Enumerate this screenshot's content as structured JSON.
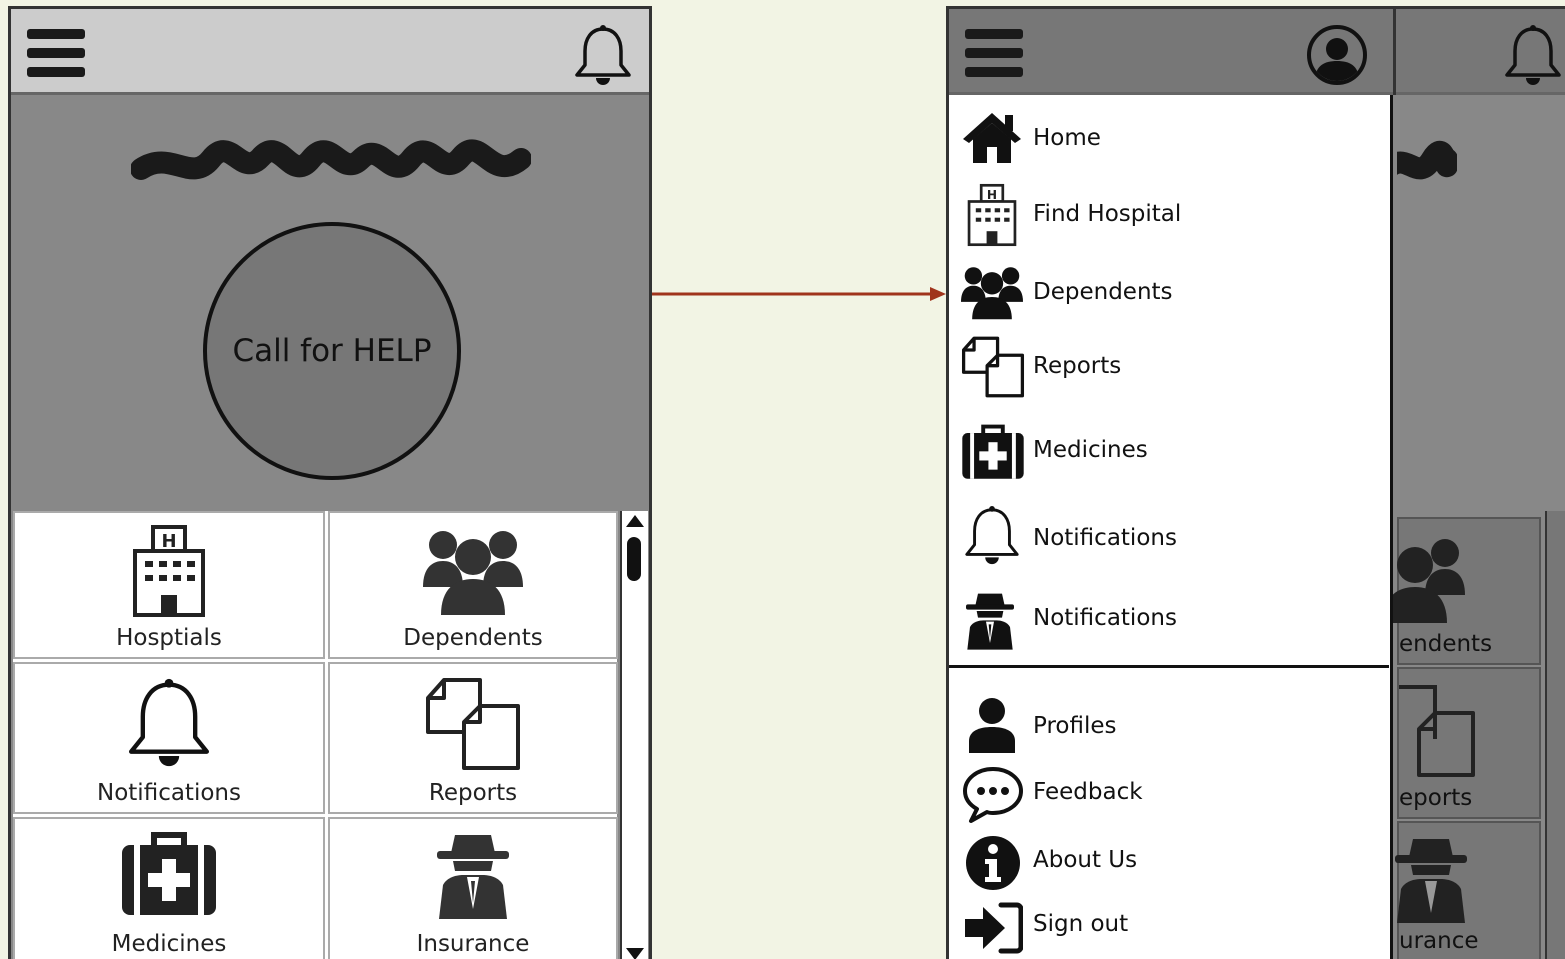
{
  "left_screen": {
    "help_button_label": "Call for HELP",
    "tiles": [
      {
        "label": "Hosptials",
        "icon": "hospital-icon"
      },
      {
        "label": "Dependents",
        "icon": "group-icon"
      },
      {
        "label": "Notifications",
        "icon": "bell-icon"
      },
      {
        "label": "Reports",
        "icon": "documents-icon"
      },
      {
        "label": "Medicines",
        "icon": "medical-kit-icon"
      },
      {
        "label": "Insurance",
        "icon": "spy-icon"
      }
    ]
  },
  "right_screen": {
    "menu_items": [
      {
        "label": "Home",
        "icon": "home-icon"
      },
      {
        "label": "Find Hospital",
        "icon": "hospital-icon"
      },
      {
        "label": "Dependents",
        "icon": "group-icon"
      },
      {
        "label": "Reports",
        "icon": "documents-icon"
      },
      {
        "label": "Medicines",
        "icon": "medical-kit-icon"
      },
      {
        "label": "Notifications",
        "icon": "bell-icon"
      },
      {
        "label": "Notifications",
        "icon": "spy-icon"
      }
    ],
    "secondary_items": [
      {
        "label": "Profiles",
        "icon": "user-icon"
      },
      {
        "label": "Feedback",
        "icon": "speech-bubble-icon"
      },
      {
        "label": "About Us",
        "icon": "info-icon"
      },
      {
        "label": "Sign out",
        "icon": "sign-out-icon"
      }
    ],
    "background_labels": [
      "endents",
      "eports",
      "urance"
    ]
  },
  "colors": {
    "arrow": "#a0341c",
    "background": "#f2f4e4",
    "header_light": "#cccccc",
    "content_gray": "#888888"
  }
}
